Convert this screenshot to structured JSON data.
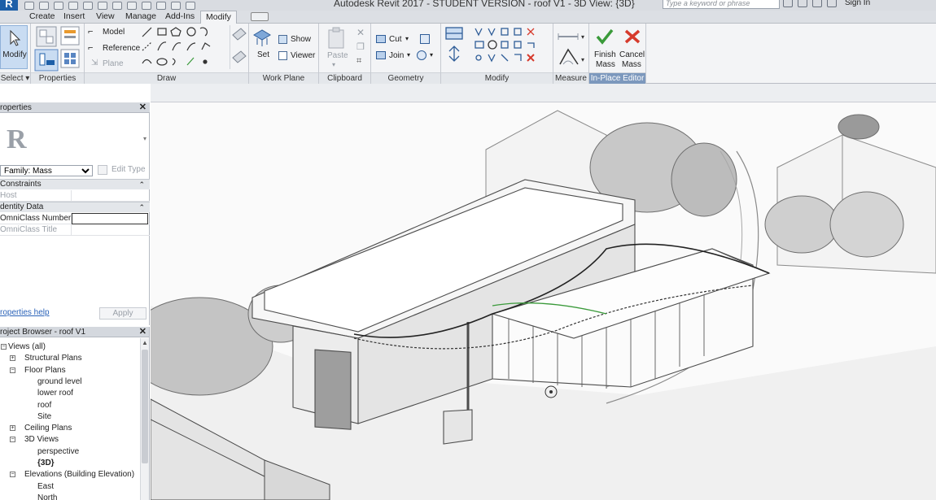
{
  "app": {
    "title": "Autodesk Revit 2017 -  STUDENT VERSION -    roof V1 - 3D View: {3D}",
    "search_placeholder": "Type a keyword or phrase",
    "sign_in": "Sign In"
  },
  "menu": {
    "tabs": [
      "Create",
      "Insert",
      "View",
      "Manage",
      "Add-Ins",
      "Modify"
    ],
    "active": "Modify"
  },
  "ribbon": {
    "select": {
      "modify_label": "Modify",
      "panel_label": "Select ▾"
    },
    "properties": {
      "panel_label": "Properties"
    },
    "draw": {
      "model_label": "Model",
      "reference_label": "Reference",
      "plane_label": "Plane",
      "panel_label": "Draw"
    },
    "work_plane": {
      "set_label": "Set",
      "show_label": "Show",
      "viewer_label": "Viewer",
      "panel_label": "Work Plane"
    },
    "clipboard": {
      "paste_label": "Paste",
      "panel_label": "Clipboard"
    },
    "geometry": {
      "cut_label": "Cut",
      "join_label": "Join",
      "panel_label": "Geometry"
    },
    "modify": {
      "panel_label": "Modify"
    },
    "measure": {
      "panel_label": "Measure"
    },
    "inplace": {
      "finish_label": "Finish Mass",
      "finish_line1": "Finish",
      "finish_line2": "Mass",
      "cancel_line1": "Cancel",
      "cancel_line2": "Mass",
      "panel_label": "In-Place Editor"
    }
  },
  "properties_palette": {
    "header": "roperties",
    "type_glyph": "R",
    "family_value": "Family: Mass",
    "edit_type_label": "Edit Type",
    "groups": [
      {
        "name": "Constraints",
        "rows": [
          {
            "key": "Host",
            "disabled": true
          }
        ]
      },
      {
        "name": "dentity Data",
        "rows": [
          {
            "key": "OmniClass Number",
            "disabled": false
          },
          {
            "key": "OmniClass Title",
            "disabled": true
          }
        ]
      }
    ],
    "help_link": "roperties help",
    "apply_label": "Apply"
  },
  "project_browser": {
    "header": "roject Browser - roof V1",
    "items": [
      {
        "label": "Views (all)",
        "level": 0
      },
      {
        "label": "Structural Plans",
        "level": 1
      },
      {
        "label": "Floor Plans",
        "level": 1
      },
      {
        "label": "ground level",
        "level": 2
      },
      {
        "label": "lower roof",
        "level": 2
      },
      {
        "label": "roof",
        "level": 2
      },
      {
        "label": "Site",
        "level": 2
      },
      {
        "label": "Ceiling Plans",
        "level": 1
      },
      {
        "label": "3D Views",
        "level": 1
      },
      {
        "label": "perspective",
        "level": 2
      },
      {
        "label": "{3D}",
        "level": 2
      },
      {
        "label": "Elevations (Building Elevation)",
        "level": 1
      },
      {
        "label": "East",
        "level": 2
      },
      {
        "label": "North",
        "level": 2
      }
    ]
  },
  "colors": {
    "accent_blue": "#1d5fa8",
    "finish_green": "#3a9a3a",
    "cancel_red": "#d63a2c",
    "inplace_panel": "#7c98bd"
  }
}
